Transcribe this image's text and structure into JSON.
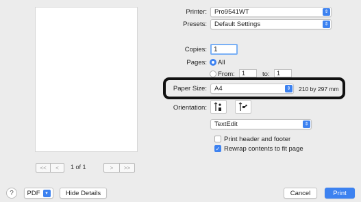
{
  "printer": {
    "label": "Printer:",
    "value": "Pro9541WT"
  },
  "presets": {
    "label": "Presets:",
    "value": "Default Settings"
  },
  "copies": {
    "label": "Copies:",
    "value": "1"
  },
  "pages": {
    "label": "Pages:",
    "all_label": "All",
    "from_label": "From:",
    "from_value": "1",
    "to_label": "to:",
    "to_value": "1",
    "selected": "All"
  },
  "paper_size": {
    "label": "Paper Size:",
    "value": "A4",
    "dimensions": "210 by 297 mm"
  },
  "orientation": {
    "label": "Orientation:",
    "selected": "portrait"
  },
  "app_section": {
    "value": "TextEdit"
  },
  "options": [
    {
      "label": "Print header and footer",
      "checked": false
    },
    {
      "label": "Rewrap contents to fit page",
      "checked": true
    }
  ],
  "preview": {
    "page_count": "1 of 1",
    "first_label": "<<",
    "prev_label": "<",
    "next_label": ">",
    "last_label": ">>"
  },
  "bottom": {
    "help_label": "?",
    "pdf_label": "PDF",
    "hide_details_label": "Hide Details",
    "cancel_label": "Cancel",
    "print_label": "Print"
  },
  "colors": {
    "accent": "#3d82f0",
    "callout": "#111111",
    "background": "#ececec"
  },
  "icons": {
    "popup_arrow": "updown-chevron-icon",
    "portrait": "portrait-orientation-icon",
    "landscape": "landscape-orientation-icon",
    "checkmark": "checkmark-icon"
  }
}
